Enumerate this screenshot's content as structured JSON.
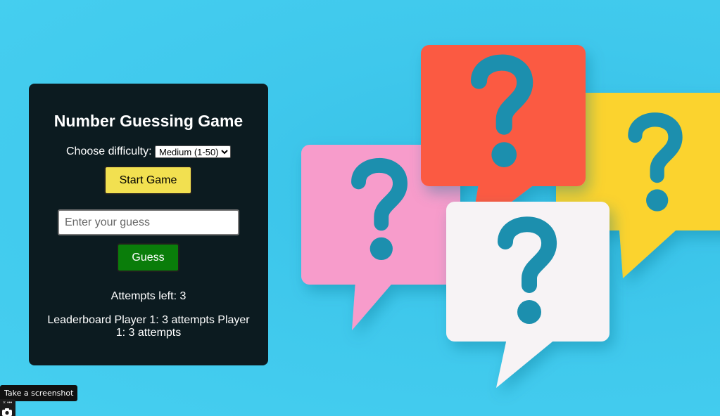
{
  "game": {
    "title": "Number Guessing Game",
    "difficulty_label": "Choose difficulty:",
    "difficulty_selected": "Medium (1-50)",
    "start_button": "Start Game",
    "guess_placeholder": "Enter your guess",
    "guess_button": "Guess",
    "attempts_text": "Attempts left: 3",
    "leaderboard_text": "Leaderboard Player 1: 3 attempts Player 1: 3 attempts"
  },
  "overlay": {
    "tooltip": "Take a screenshot",
    "camera_icon": "camera-icon",
    "dots_icon": "more-dots-icon"
  },
  "illustration": {
    "icon": "question-bubbles-illustration",
    "colors": {
      "background": "#3ec5ea",
      "pink_bubble": "#f79ccb",
      "red_bubble": "#fb5a43",
      "yellow_bubble": "#fbd32f",
      "white_bubble": "#f7f3f5",
      "question_mark": "#1a8fae"
    }
  },
  "colors": {
    "card": "#0c1b20",
    "start_button": "#f2e050",
    "guess_button": "#0a7d0a"
  }
}
